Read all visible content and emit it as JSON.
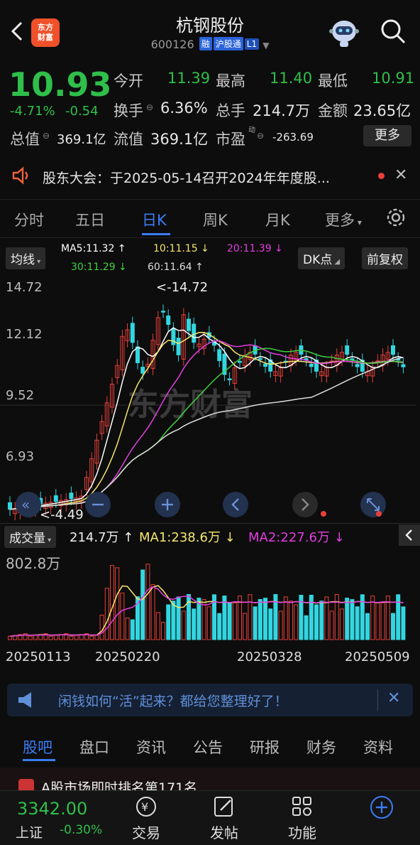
{
  "header": {
    "logo_line1": "东方",
    "logo_line2": "财富",
    "title": "杭钢股份",
    "code": "600126",
    "tags": [
      "融",
      "沪股通",
      "L1"
    ]
  },
  "quote": {
    "price": "10.93",
    "change_pct": "-4.71%",
    "change": "-0.54",
    "open_label": "今开",
    "open": "11.39",
    "high_label": "最高",
    "high": "11.40",
    "low_label": "最低",
    "low": "10.91",
    "turnover_label": "换手",
    "turnover": "6.36%",
    "volume_label": "总手",
    "volume": "214.7万",
    "amount_label": "金额",
    "amount": "23.65亿",
    "mktcap_label": "总值",
    "mktcap": "369.1亿",
    "float_label": "流值",
    "float": "369.1亿",
    "pe_label": "市盈",
    "pe_sup": "动",
    "pe": "-263.69",
    "more": "更多"
  },
  "notice": {
    "text": "股东大会：于2025-05-14召开2024年年度股..."
  },
  "ktabs": [
    "分时",
    "五日",
    "日K",
    "周K",
    "月K",
    "更多"
  ],
  "indicators": {
    "ma_select": "均线",
    "ma5": "MA5:11.32 ↑",
    "ma10": "10:11.15 ↓",
    "ma20": "20:11.39 ↓",
    "ma30": "30:11.29 ↓",
    "ma60": "60:11.64 ↑",
    "dk": "DK点",
    "adjust": "前复权"
  },
  "kchart": {
    "y_ticks": [
      "14.72",
      "12.12",
      "9.52",
      "6.93"
    ],
    "high_label": "<-14.72",
    "low_label": "<-4.49",
    "watermark": "东方财富"
  },
  "volume": {
    "select": "成交量",
    "vol": "214.7万 ↑",
    "ma1": "MA1:238.6万 ↓",
    "ma2": "MA2:227.6万 ↓",
    "y_top": "802.8万",
    "dates": [
      "20250113",
      "20250220",
      "20250328",
      "20250509"
    ]
  },
  "ad": {
    "text": "闲钱如何“活”起来？都给您整理好了！"
  },
  "section_tabs": [
    "股吧",
    "盘口",
    "资讯",
    "公告",
    "研报",
    "财务",
    "资料"
  ],
  "peek": {
    "text": "A股市场即时排名第171名"
  },
  "bottom": {
    "index_value": "3342.00",
    "index_name": "上证",
    "index_change": "-0.30%",
    "nav": [
      "交易",
      "发帖",
      "功能"
    ]
  },
  "colors": {
    "up": "#e8403a",
    "down": "#2fbf4a",
    "accent": "#3a7cf5",
    "ma5": "#ffffff",
    "ma10": "#f5e66b",
    "ma20": "#e23ee0",
    "ma30": "#3fd13f",
    "ma60": "#dddddd",
    "down_bar": "#33d6e0"
  }
}
